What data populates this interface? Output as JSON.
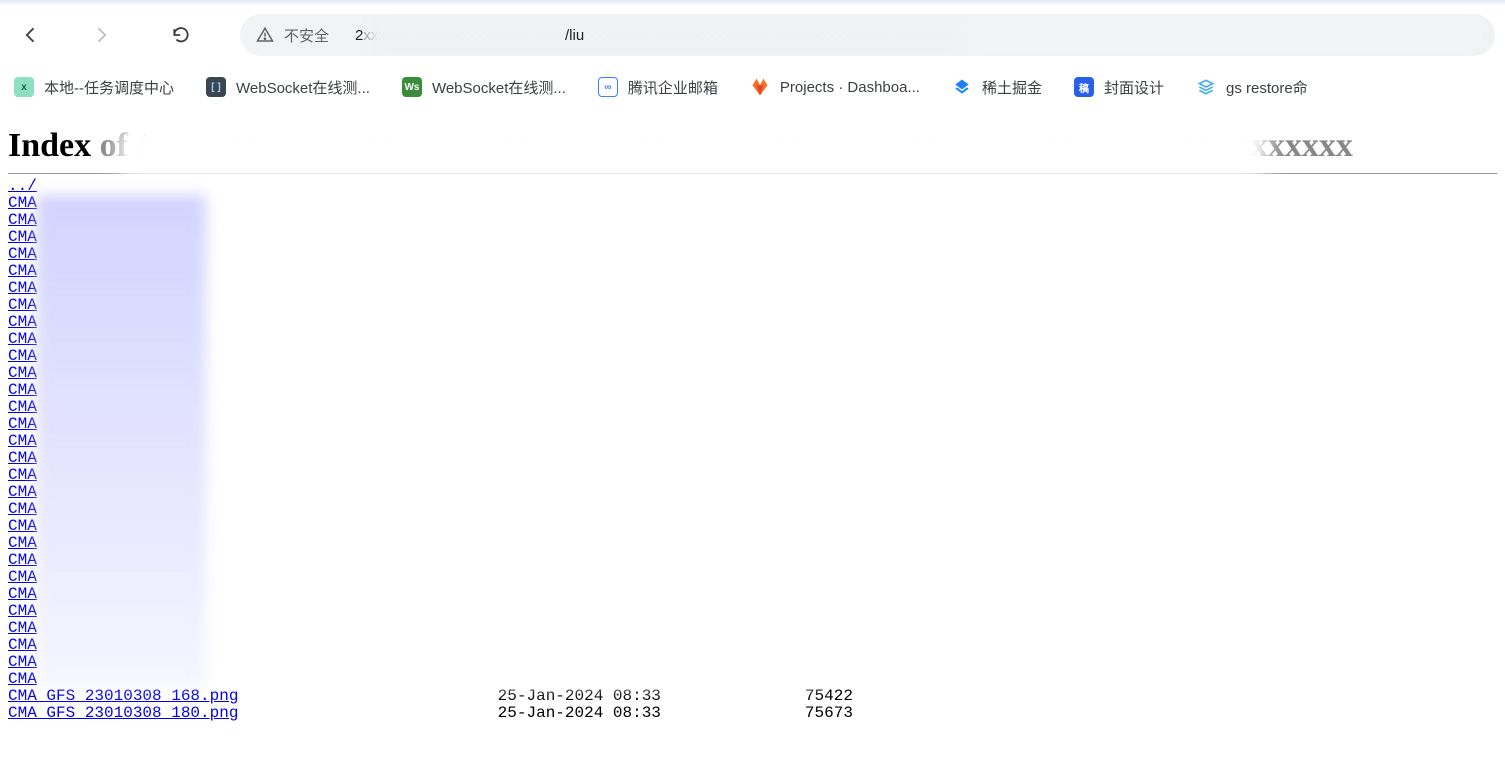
{
  "toolbar": {
    "not_secure_label": "不安全",
    "url_visible_prefix": "2",
    "url_visible_suffix": "/liu"
  },
  "bookmarks": {
    "items": [
      {
        "label": "本地--任务调度中心",
        "icon_bg": "#8ee0c0",
        "icon_text": "XXL"
      },
      {
        "label": "WebSocket在线测...",
        "icon_bg": "#3b4650",
        "icon_text": "[]"
      },
      {
        "label": "WebSocket在线测...",
        "icon_bg": "#3a8c3a",
        "icon_text": "Ws"
      },
      {
        "label": "腾讯企业邮箱",
        "icon_bg": "#ffffff",
        "icon_text": "∞",
        "icon_border": "#3b7fff"
      },
      {
        "label": "Projects · Dashboa...",
        "icon_bg": "#ffffff",
        "icon_text": "",
        "gitlab": true
      },
      {
        "label": "稀土掘金",
        "icon_bg": "#ffffff",
        "icon_text": "",
        "juejin": true
      },
      {
        "label": "封面设计",
        "icon_bg": "#2a60e8",
        "icon_text": "稿"
      },
      {
        "label": "gs restore命",
        "icon_bg": "#ffffff",
        "icon_text": "",
        "stack": true
      }
    ]
  },
  "page": {
    "heading_prefix": "Index",
    "parent_link": "../",
    "cma_prefix": "CMA",
    "files_blurred_count": 29,
    "files_clear": [
      {
        "name": "CMA GFS 23010308 168.png",
        "date": "25-Jan-2024 08:33",
        "size": "75422"
      },
      {
        "name": "CMA GFS 23010308 180.png",
        "date": "25-Jan-2024 08:33",
        "size": "75673"
      }
    ]
  }
}
